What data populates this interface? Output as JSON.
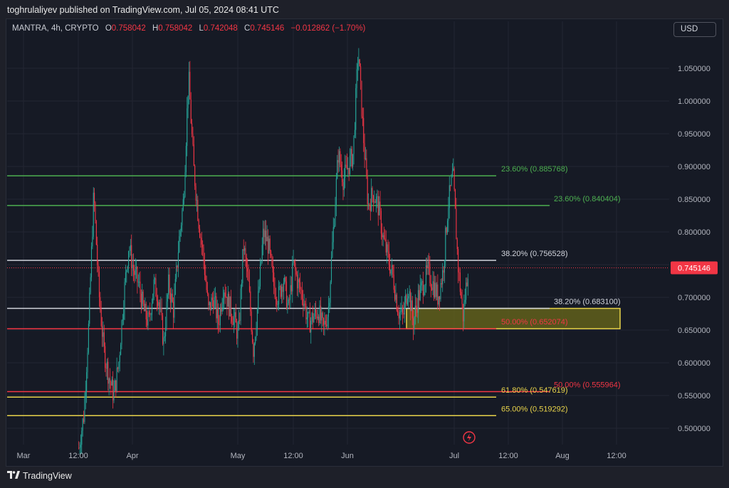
{
  "publisher": "toghrulaliyev published on TradingView.com, Jul 05, 2024 08:41 UTC",
  "legend": {
    "symbol": "MANTRA, 4h, CRYPTO",
    "open_label": "O",
    "open": "0.758042",
    "high_label": "H",
    "high": "0.758042",
    "low_label": "L",
    "low": "0.742048",
    "close_label": "C",
    "close": "0.745146",
    "change": "−0.012862 (−1.70%)"
  },
  "currency_button": "USD",
  "footer_brand": "TradingView",
  "colors": {
    "up": "#26a69a",
    "down": "#f23645",
    "green_fib": "#4caf50",
    "white_fib": "#d1d4dc",
    "red_fib": "#f23645",
    "yellow_fib": "#e8d34a",
    "zone_fill": "#6b6a1a",
    "zone_border": "#e8d34a"
  },
  "chart_data": {
    "type": "candlestick",
    "timeframe": "4h",
    "y_ticks": [
      "1.050000",
      "1.000000",
      "0.950000",
      "0.900000",
      "0.850000",
      "0.800000",
      "0.750000",
      "0.700000",
      "0.650000",
      "0.600000",
      "0.550000",
      "0.500000"
    ],
    "y_tick_values": [
      1.05,
      1.0,
      0.95,
      0.9,
      0.85,
      0.8,
      0.75,
      0.7,
      0.65,
      0.6,
      0.55,
      0.5
    ],
    "ylim": [
      0.475,
      1.1
    ],
    "x_ticks": [
      "Mar",
      "12:00",
      "Apr",
      "May",
      "12:00",
      "Jun",
      "Jul",
      "12:00",
      "Aug",
      "12:00"
    ],
    "last_price": "0.745146",
    "fib_levels": [
      {
        "label": "23.60% (0.885768)",
        "value": 0.885768,
        "color": "green",
        "end": "near"
      },
      {
        "label": "23.60% (0.840404)",
        "value": 0.840404,
        "color": "green",
        "end": "far"
      },
      {
        "label": "38.20% (0.756528)",
        "value": 0.756528,
        "color": "white",
        "end": "near"
      },
      {
        "label": "38.20% (0.683100)",
        "value": 0.6831,
        "color": "white",
        "end": "far"
      },
      {
        "label": "50.00% (0.652074)",
        "value": 0.652074,
        "color": "red",
        "end": "near"
      },
      {
        "label": "50.00% (0.555964)",
        "value": 0.555964,
        "color": "red",
        "end": "far"
      },
      {
        "label": "61.80% (0.547619)",
        "value": 0.547619,
        "color": "yellow",
        "end": "near"
      },
      {
        "label": "65.00% (0.519292)",
        "value": 0.519292,
        "color": "yellow",
        "end": "near"
      }
    ],
    "support_zone": {
      "low": 0.652074,
      "high": 0.6831
    },
    "price_path": [
      0.47,
      0.52,
      0.66,
      0.86,
      0.71,
      0.62,
      0.58,
      0.55,
      0.6,
      0.7,
      0.78,
      0.74,
      0.72,
      0.68,
      0.66,
      0.72,
      0.7,
      0.63,
      0.72,
      0.68,
      0.78,
      0.85,
      1.04,
      0.9,
      0.82,
      0.76,
      0.68,
      0.7,
      0.66,
      0.72,
      0.69,
      0.67,
      0.64,
      0.78,
      0.72,
      0.62,
      0.7,
      0.8,
      0.78,
      0.72,
      0.7,
      0.73,
      0.68,
      0.75,
      0.72,
      0.7,
      0.66,
      0.67,
      0.68,
      0.65,
      0.68,
      0.8,
      0.92,
      0.88,
      0.9,
      0.92,
      1.08,
      0.95,
      0.84,
      0.86,
      0.84,
      0.79,
      0.76,
      0.73,
      0.68,
      0.67,
      0.72,
      0.66,
      0.7,
      0.72,
      0.74,
      0.72,
      0.7,
      0.74,
      0.84,
      0.89,
      0.75,
      0.67,
      0.745
    ]
  }
}
